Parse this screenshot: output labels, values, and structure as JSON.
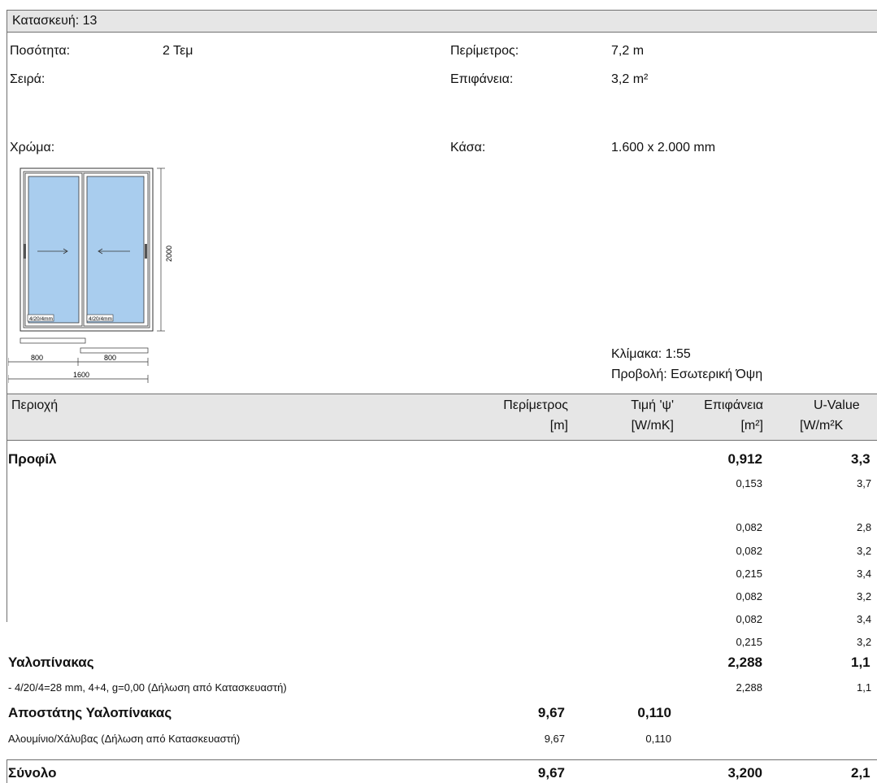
{
  "header": {
    "construction": "Κατασκευή: 13"
  },
  "info": {
    "quantity_label": "Ποσότητα:",
    "quantity_value": "2 Τεμ",
    "series_label": "Σειρά:",
    "color_label": "Χρώμα:",
    "perimeter_label": "Περίμετρος:",
    "perimeter_value": "7,2 m",
    "surface_label": "Επιφάνεια:",
    "surface_value": "3,2 m²",
    "frame_label": "Κάσα:",
    "frame_value": "1.600 x 2.000 mm",
    "scale": "Κλίμακα: 1:55",
    "view": "Προβολή: Εσωτερική Όψη"
  },
  "drawing": {
    "glass_label_left": "4/20/4mm",
    "glass_label_right": "4/20/4mm",
    "height_dim": "2000",
    "width_left": "800",
    "width_right": "800",
    "width_total": "1600",
    "glass_color": "#a9cdee"
  },
  "table": {
    "headers": {
      "area": "Περιοχή",
      "perimeter": "Περίμετρος",
      "perimeter_unit": "[m]",
      "psi": "Τιμή 'ψ'",
      "psi_unit": "[W/mK]",
      "surface": "Επιφάνεια",
      "surface_unit": "[m²]",
      "uvalue": "U-Value",
      "uvalue_unit": "[W/m²K"
    },
    "profile": {
      "label": "Προφίλ",
      "surface": "0,912",
      "uvalue": "3,3"
    },
    "profile_rows": [
      {
        "surface": "0,153",
        "uvalue": "3,7"
      },
      {
        "surface": "0,082",
        "uvalue": "2,8"
      },
      {
        "surface": "0,082",
        "uvalue": "3,2"
      },
      {
        "surface": "0,215",
        "uvalue": "3,4"
      },
      {
        "surface": "0,082",
        "uvalue": "3,2"
      },
      {
        "surface": "0,082",
        "uvalue": "3,4"
      },
      {
        "surface": "0,215",
        "uvalue": "3,2"
      }
    ],
    "glazing": {
      "label": "Υαλοπίνακας",
      "surface": "2,288",
      "uvalue": "1,1"
    },
    "glazing_row": {
      "label": "- 4/20/4=28 mm, 4+4, g=0,00 (Δήλωση από Κατασκευαστή)",
      "surface": "2,288",
      "uvalue": "1,1"
    },
    "spacer": {
      "label": "Αποστάτης Υαλοπίνακας",
      "perimeter": "9,67",
      "psi": "0,110"
    },
    "spacer_row": {
      "label": "Αλουμίνιο/Χάλυβας (Δήλωση από Κατασκευαστή)",
      "perimeter": "9,67",
      "psi": "0,110"
    },
    "total": {
      "label": "Σύνολο",
      "perimeter": "9,67",
      "surface": "3,200",
      "uvalue": "2,1"
    }
  }
}
